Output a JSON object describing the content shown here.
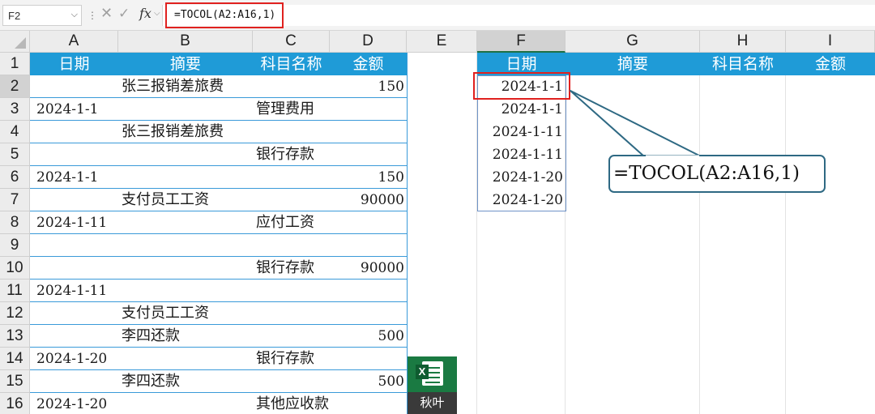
{
  "formula_bar": {
    "name_box": "F2",
    "cancel_icon": "x-icon",
    "confirm_icon": "check-icon",
    "fx_label": "fx",
    "formula": "=TOCOL(A2:A16,1)"
  },
  "columns": [
    "A",
    "B",
    "C",
    "D",
    "E",
    "F",
    "G",
    "H",
    "I"
  ],
  "rows": [
    "1",
    "2",
    "3",
    "4",
    "5",
    "6",
    "7",
    "8",
    "9",
    "10",
    "11",
    "12",
    "13",
    "14",
    "15",
    "16"
  ],
  "source_table": {
    "headers": [
      "日期",
      "摘要",
      "科目名称",
      "金额"
    ],
    "rows": [
      {
        "date": "",
        "summary": "张三报销差旅费",
        "account": "",
        "amount": "150"
      },
      {
        "date": "2024-1-1",
        "summary": "",
        "account": "管理费用",
        "amount": ""
      },
      {
        "date": "",
        "summary": "张三报销差旅费",
        "account": "",
        "amount": ""
      },
      {
        "date": "",
        "summary": "",
        "account": "银行存款",
        "amount": ""
      },
      {
        "date": "2024-1-1",
        "summary": "",
        "account": "",
        "amount": "150"
      },
      {
        "date": "",
        "summary": "支付员工工资",
        "account": "",
        "amount": "90000"
      },
      {
        "date": "2024-1-11",
        "summary": "",
        "account": "应付工资",
        "amount": ""
      },
      {
        "date": "",
        "summary": "",
        "account": "",
        "amount": ""
      },
      {
        "date": "",
        "summary": "",
        "account": "银行存款",
        "amount": "90000"
      },
      {
        "date": "2024-1-11",
        "summary": "",
        "account": "",
        "amount": ""
      },
      {
        "date": "",
        "summary": "支付员工工资",
        "account": "",
        "amount": ""
      },
      {
        "date": "",
        "summary": "李四还款",
        "account": "",
        "amount": "500"
      },
      {
        "date": "2024-1-20",
        "summary": "",
        "account": "银行存款",
        "amount": ""
      },
      {
        "date": "",
        "summary": "李四还款",
        "account": "",
        "amount": "500"
      },
      {
        "date": "2024-1-20",
        "summary": "",
        "account": "其他应收款",
        "amount": ""
      }
    ]
  },
  "result_table": {
    "headers": [
      "日期",
      "摘要",
      "科目名称",
      "金额"
    ],
    "dates": [
      "2024-1-1",
      "2024-1-1",
      "2024-1-11",
      "2024-1-11",
      "2024-1-20",
      "2024-1-20"
    ]
  },
  "callout": {
    "text": "=TOCOL(A2:A16,1)"
  },
  "logo": {
    "badge": "X",
    "label": "秋叶",
    "icon": "excel-sheet-icon"
  },
  "colors": {
    "header_blue": "#1f9bd7",
    "highlight_red": "#e0211f",
    "callout_border": "#2e6983",
    "logo_green": "#1a7a42"
  }
}
